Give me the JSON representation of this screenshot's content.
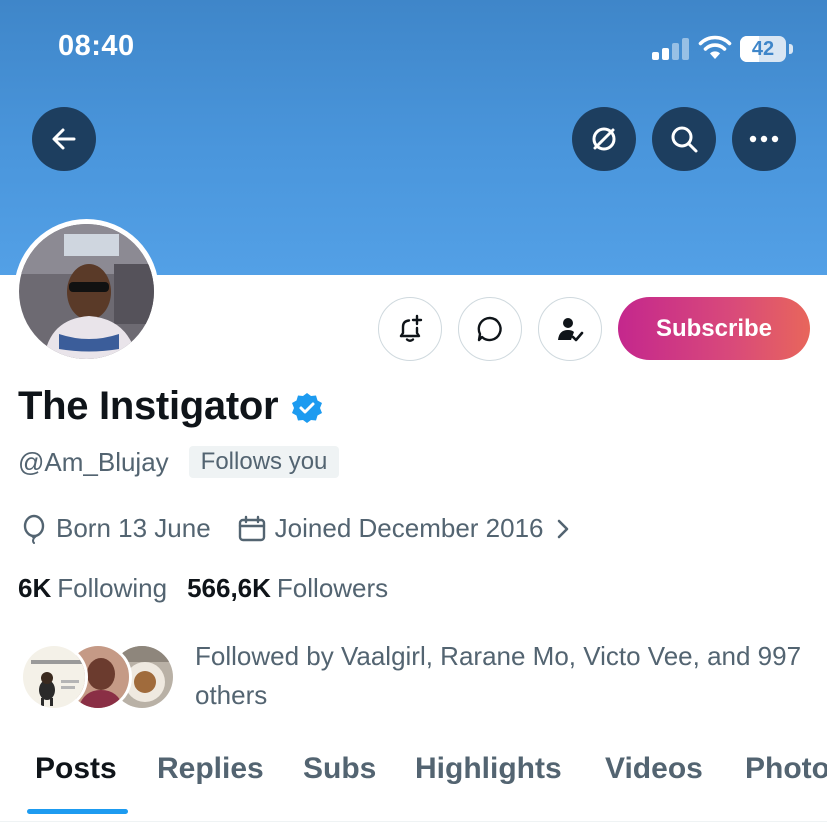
{
  "status_bar": {
    "time": "08:40",
    "battery_level": "42",
    "battery_fraction": 0.42,
    "signal_icon": "cellular-signal-icon",
    "wifi_icon": "wifi-icon"
  },
  "header": {
    "back_icon": "arrow-left-icon",
    "grok_icon": "slashed-circle-icon",
    "search_icon": "search-icon",
    "more_icon": "more-dots-icon"
  },
  "actions": {
    "notify_icon": "bell-plus-icon",
    "message_icon": "message-bubble-icon",
    "follow_icon": "person-check-icon",
    "subscribe_label": "Subscribe"
  },
  "profile": {
    "display_name": "The Instigator",
    "handle": "@Am_Blujay",
    "follows_you_badge": "Follows you",
    "birthday": "Born 13 June",
    "joined": "Joined December 2016",
    "following_count": "6K",
    "following_label": "Following",
    "followers_count": "566,6K",
    "followers_label": "Followers",
    "followed_by": "Followed by Vaalgirl, Rarane Mo, Victo Vee, and 997 others"
  },
  "tabs": [
    {
      "label": "Posts",
      "active": true
    },
    {
      "label": "Replies",
      "active": false
    },
    {
      "label": "Subs",
      "active": false
    },
    {
      "label": "Highlights",
      "active": false
    },
    {
      "label": "Videos",
      "active": false
    },
    {
      "label": "Photos",
      "active": false
    }
  ],
  "colors": {
    "banner": "#4a96dc",
    "header_button": "#1d3e5f",
    "verified": "#1d9bf0",
    "subscribe_start": "#c4278d",
    "subscribe_end": "#e8665b",
    "tab_indicator": "#1d9bf0"
  }
}
